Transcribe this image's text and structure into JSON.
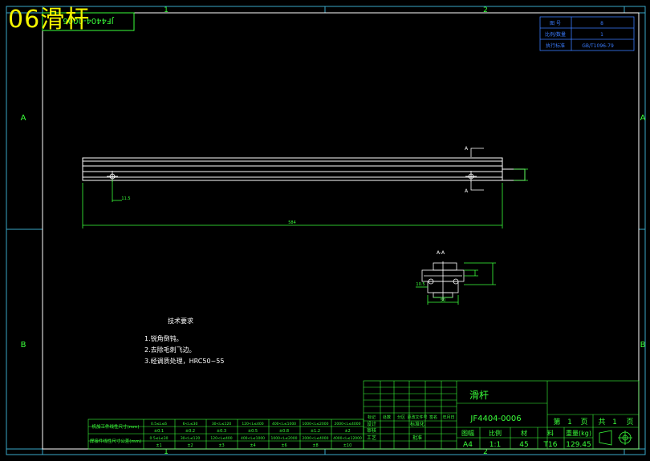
{
  "overlay_title": "06滑杆",
  "corner_label": "JF4404-0006",
  "zone_cols": [
    "1",
    "2"
  ],
  "zone_rows": [
    "A",
    "B"
  ],
  "top_right_table": [
    {
      "label": "图 号",
      "value": "8"
    },
    {
      "label": "比例/数量",
      "value": "1"
    },
    {
      "label": "执行标准",
      "value": "GB/T1096-79"
    }
  ],
  "section_marks": {
    "top": "A",
    "bottom": "A",
    "view_label": "A-A"
  },
  "dimensions": {
    "overall_length": "584",
    "hole_offset": "11.5",
    "left_small": "10.5",
    "section_bottom": "50"
  },
  "technical_requirements": {
    "heading": "技术要求",
    "items": [
      "1.锐角倒钝。",
      "2.去除毛刺飞边。",
      "3.经调质处理，HRC50~55"
    ]
  },
  "tolerance_table": {
    "row1_label": "机加工件线性尺寸(mm)",
    "row2_label": "焊接件线性尺寸公差(mm)",
    "ranges1": [
      "0.5≤L≤6",
      "6<L≤30",
      "30<L≤120",
      "120<L≤400",
      "400<L≤1000",
      "1000<L≤2000",
      "2000<L≤4000"
    ],
    "vals1": [
      "±0.1",
      "±0.2",
      "±0.3",
      "±0.5",
      "±0.8",
      "±1.2",
      "±2"
    ],
    "ranges2": [
      "0.5≤L≤30",
      "30<L≤120",
      "120<L≤400",
      "400<L≤1000",
      "1000<L≤2000",
      "2000<L≤4000",
      "4000<L≤12000"
    ],
    "vals2": [
      "±1",
      "±2",
      "±3",
      "±4",
      "±6",
      "±8",
      "±10"
    ]
  },
  "title_block": {
    "part_name": "滑杆",
    "drawing_no": "JF4404-0006",
    "sign_cols": [
      "标记",
      "处数",
      "分区",
      "更改文件号",
      "签名",
      "年月日"
    ],
    "roles": [
      "设计",
      "审核",
      "工艺",
      "批准"
    ],
    "standard": "标准化",
    "sheet_label_a": "第",
    "sheet_num": "1",
    "sheet_unit_a": "页",
    "total_label": "共",
    "total_num": "1",
    "total_unit": "页",
    "headers": [
      "图幅",
      "比例",
      "材",
      "料",
      "重量(kg)"
    ],
    "values": [
      "A4",
      "1:1",
      "45",
      "T16",
      "129.45"
    ]
  }
}
